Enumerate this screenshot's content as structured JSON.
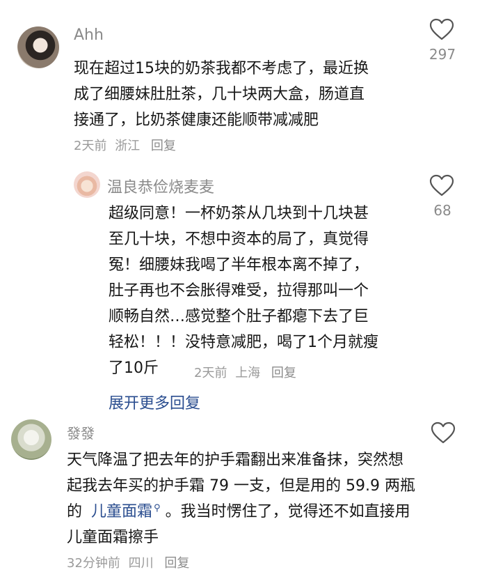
{
  "comments": [
    {
      "username": "Ahh",
      "lines": [
        "现在超过15块的奶茶我都不考虑了，最近换",
        "成了细腰妹肚肚茶，几十块两大盒，肠道直",
        "接通了，比奶茶健康还能顺带减减肥"
      ],
      "meta_time": "2天前",
      "meta_location": "浙江",
      "reply_label": "回复",
      "likes": "297"
    },
    {
      "username": "温良恭俭烧麦麦",
      "lines": [
        "超级同意！一杯奶茶从几块到十几块甚",
        "至几十块，不想中资本的局了，真觉得",
        "冤！细腰妹我喝了半年根本离不掉了，",
        "肚子再也不会胀得难受，拉得那叫一个",
        "顺畅自然…感觉整个肚子都瘪下去了巨",
        "轻松！！！没特意减肥，喝了1个月就瘦",
        "了10斤"
      ],
      "meta_time": "2天前",
      "meta_location": "上海",
      "reply_label": "回复",
      "likes": "68",
      "expand_label": "展开更多回复"
    },
    {
      "username": "發發",
      "line1": "天气降温了把去年的护手霜翻出来准备抹，突然想",
      "line2": "起我去年买的护手霜 79 一支，但是用的 59.9 两瓶",
      "line3_prefix": "的",
      "line3_link": "儿童面霜",
      "line3_suffix": "。我当时愣住了，觉得还不如直接用",
      "line4": "儿童面霜擦手",
      "meta_time": "32分钟前",
      "meta_location": "四川",
      "reply_label": "回复"
    }
  ],
  "icons": {
    "like": "heart-outline-icon",
    "search": "search-icon"
  },
  "colors": {
    "text": "#161616",
    "muted": "#8a8a8a",
    "link": "#2a4d8f"
  }
}
